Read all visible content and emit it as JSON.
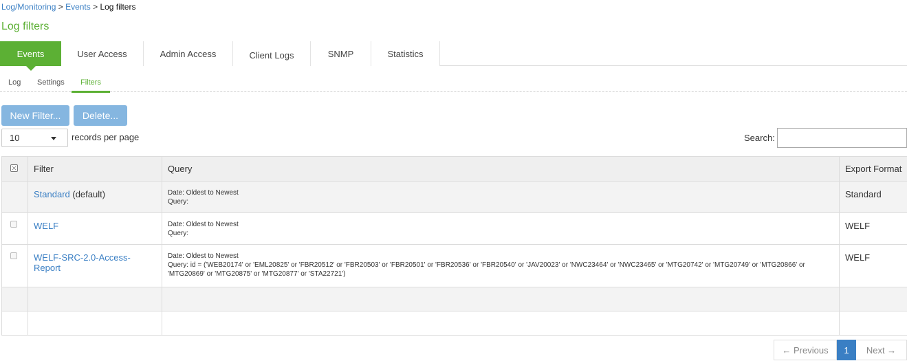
{
  "breadcrumb": {
    "level1": "Log/Monitoring",
    "sep1": " > ",
    "level2": "Events",
    "sep2": " > ",
    "current": "Log filters"
  },
  "page_title": "Log filters",
  "tabs": [
    {
      "label": "Events",
      "active": true
    },
    {
      "label": "User Access"
    },
    {
      "label": "Admin Access"
    },
    {
      "label": "Client Logs"
    },
    {
      "label": "SNMP"
    },
    {
      "label": "Statistics"
    }
  ],
  "subtabs": [
    {
      "label": "Log"
    },
    {
      "label": "Settings"
    },
    {
      "label": "Filters",
      "active": true
    }
  ],
  "toolbar": {
    "new_filter_label": "New Filter...",
    "delete_label": "Delete..."
  },
  "records_per_page": {
    "value": "10",
    "label": "records per page"
  },
  "search": {
    "label": "Search:",
    "value": ""
  },
  "table": {
    "columns": [
      "Filter",
      "Query",
      "Export Format"
    ],
    "rows": [
      {
        "filter": "Standard",
        "suffix": " (default)",
        "query_line1": "Date: Oldest to Newest",
        "query_line2": "Query:",
        "export": "Standard"
      },
      {
        "filter": "WELF",
        "suffix": "",
        "query_line1": "Date: Oldest to Newest",
        "query_line2": "Query:",
        "export": "WELF"
      },
      {
        "filter": "WELF-SRC-2.0-Access-Report",
        "suffix": "",
        "query_line1": "Date: Oldest to Newest",
        "query_line2": "Query: id = ('WEB20174' or 'EML20825' or 'FBR20512' or 'FBR20503' or 'FBR20501' or 'FBR20536' or 'FBR20540' or 'JAV20023' or 'NWC23464' or 'NWC23465' or 'MTG20742' or 'MTG20749' or 'MTG20866' or 'MTG20869' or 'MTG20875' or 'MTG20877' or 'STA22721')",
        "export": "WELF"
      }
    ]
  },
  "pagination": {
    "previous": "← Previous",
    "page": "1",
    "next": "Next →"
  },
  "colors": {
    "accent_green": "#5cb034",
    "link_blue": "#3a7fc4",
    "button_blue": "#85b6e0"
  }
}
